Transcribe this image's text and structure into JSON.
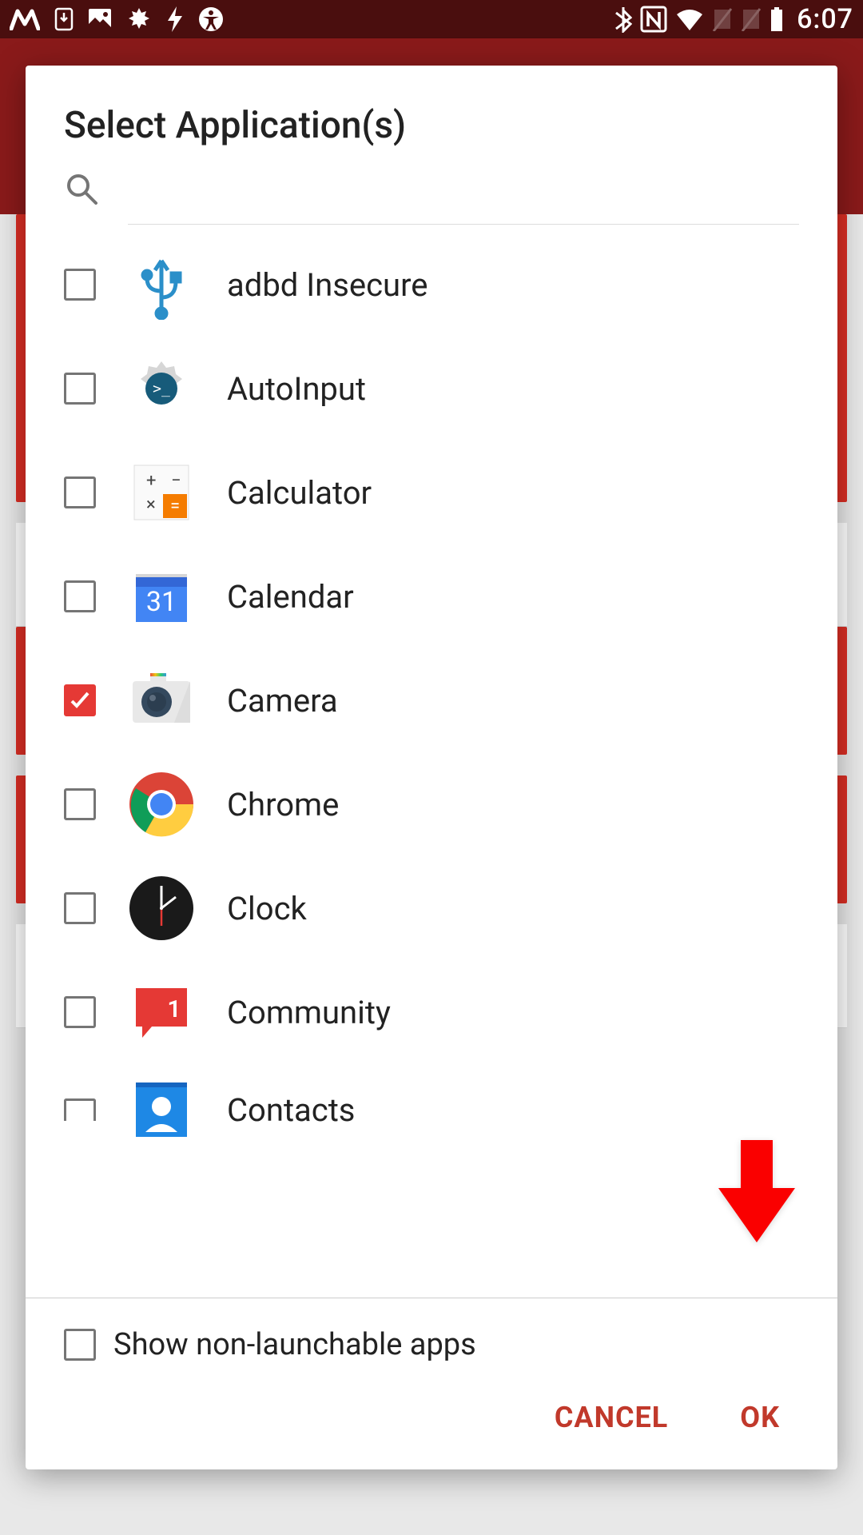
{
  "status": {
    "time": "6:07"
  },
  "dialog": {
    "title": "Select Application(s)",
    "apps": [
      {
        "name": "adbd Insecure",
        "checked": false,
        "icon": "usb"
      },
      {
        "name": "AutoInput",
        "checked": false,
        "icon": "gear-terminal"
      },
      {
        "name": "Calculator",
        "checked": false,
        "icon": "calculator"
      },
      {
        "name": "Calendar",
        "checked": false,
        "icon": "calendar-31"
      },
      {
        "name": "Camera",
        "checked": true,
        "icon": "camera"
      },
      {
        "name": "Chrome",
        "checked": false,
        "icon": "chrome"
      },
      {
        "name": "Clock",
        "checked": false,
        "icon": "clock"
      },
      {
        "name": "Community",
        "checked": false,
        "icon": "community"
      },
      {
        "name": "Contacts",
        "checked": false,
        "icon": "contacts"
      }
    ],
    "footer_option": {
      "label": "Show non-launchable apps",
      "checked": false
    },
    "actions": {
      "cancel": "CANCEL",
      "ok": "OK"
    }
  },
  "colors": {
    "accent": "#e53935",
    "danger": "#c1392b"
  }
}
